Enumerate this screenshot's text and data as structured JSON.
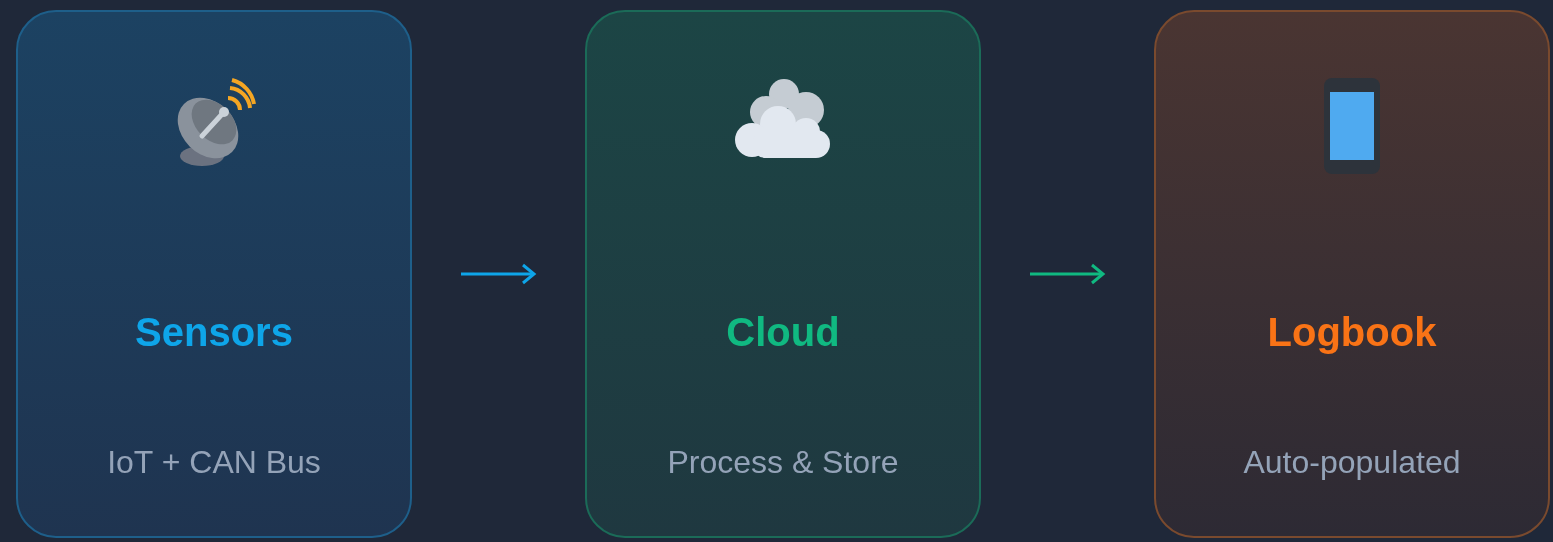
{
  "stages": [
    {
      "kind": "dish",
      "title": "Sensors",
      "subtitle": "IoT + CAN Bus",
      "color": "#0ea5e9"
    },
    {
      "kind": "cloud",
      "title": "Cloud",
      "subtitle": "Process & Store",
      "color": "#10b981"
    },
    {
      "kind": "phone",
      "title": "Logbook",
      "subtitle": "Auto-populated",
      "color": "#f97316"
    }
  ]
}
